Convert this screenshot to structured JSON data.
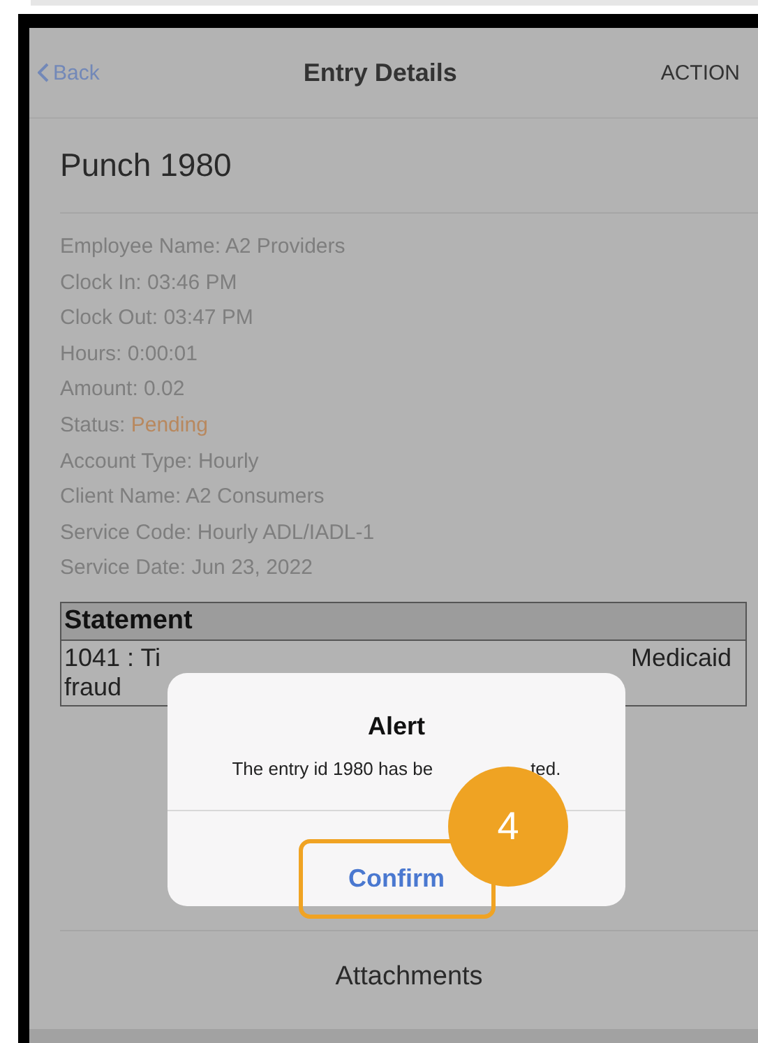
{
  "nav": {
    "back": "Back",
    "title": "Entry Details",
    "action": "ACTION"
  },
  "record_title": "Punch 1980",
  "fields": [
    {
      "label": "Employee Name:",
      "value": "A2 Providers",
      "color": "#7e7e7e"
    },
    {
      "label": "Clock In:",
      "value": "03:46 PM",
      "color": "#7e7e7e"
    },
    {
      "label": "Clock Out:",
      "value": "03:47 PM",
      "color": "#7e7e7e"
    },
    {
      "label": "Hours:",
      "value": "0:00:01",
      "color": "#7e7e7e"
    },
    {
      "label": "Amount:",
      "value": "0.02",
      "color": "#7e7e7e"
    },
    {
      "label": "Status:",
      "value": "Pending",
      "color": "#b8885e"
    },
    {
      "label": "Account Type:",
      "value": "Hourly",
      "color": "#7e7e7e"
    },
    {
      "label": "Client Name:",
      "value": "A2 Consumers",
      "color": "#7e7e7e"
    },
    {
      "label": "Service Code:",
      "value": "Hourly ADL/IADL-1",
      "color": "#7e7e7e"
    },
    {
      "label": "Service Date:",
      "value": "Jun 23, 2022",
      "color": "#7e7e7e"
    }
  ],
  "statement": {
    "header": "Statement",
    "line1_start": "1041 : Ti",
    "line1_end": "Medicaid",
    "line2": "fraud"
  },
  "alert": {
    "title": "Alert",
    "message_start": "The entry id 1980 has be",
    "message_end": "ted.",
    "button": "Confirm",
    "button_highlighted": true
  },
  "callout": "4",
  "attachments": "Attachments"
}
